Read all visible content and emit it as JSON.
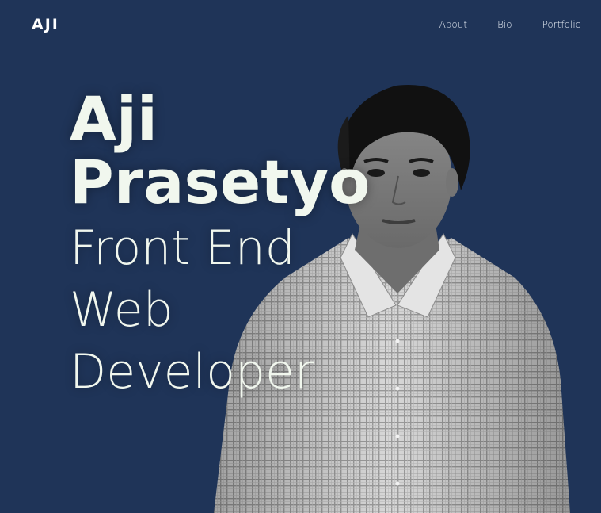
{
  "header": {
    "logo": "AJI",
    "nav": [
      {
        "label": "About"
      },
      {
        "label": "Bio"
      },
      {
        "label": "Portfolio"
      }
    ]
  },
  "hero": {
    "name_line1": "Aji",
    "name_line2": "Prasetyo",
    "role_line1": "Front End",
    "role_line2": "Web",
    "role_line3": "Developer"
  },
  "colors": {
    "background": "#1f3458",
    "hero_text": "#f1f7ee",
    "nav_text": "#e6ecf4"
  }
}
